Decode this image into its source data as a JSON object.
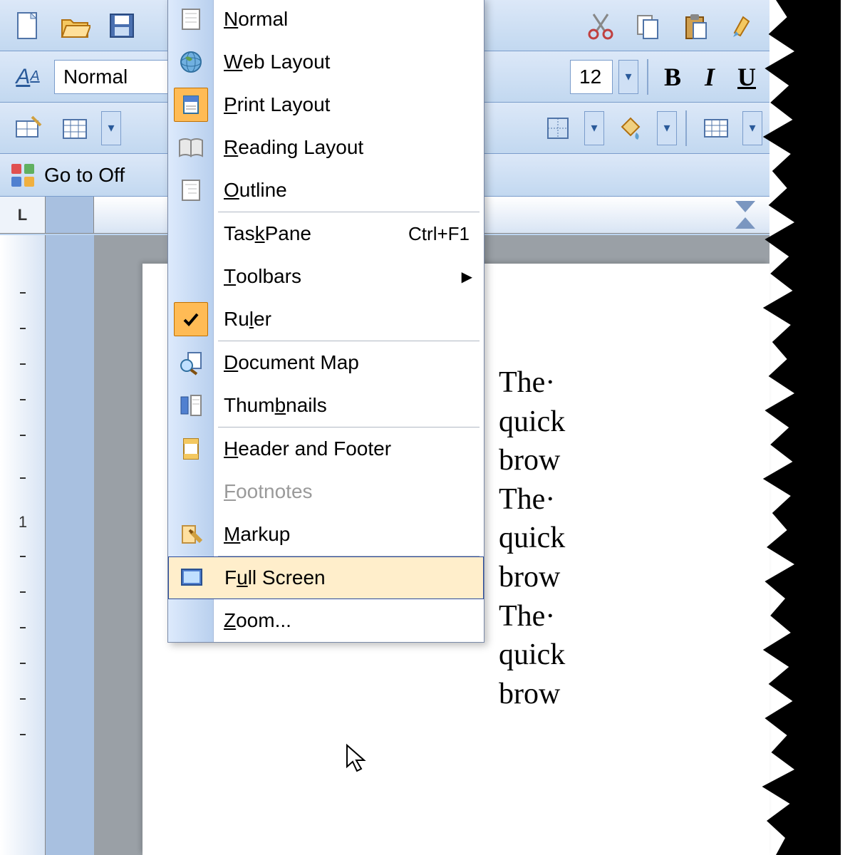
{
  "toolbar": {
    "style_label": "Normal",
    "font_size": "12",
    "go_to_office": "Go to Off"
  },
  "menu": {
    "items": [
      {
        "label_pre": "",
        "key": "N",
        "label_post": "ormal",
        "icon": "page-icon"
      },
      {
        "label_pre": "",
        "key": "W",
        "label_post": "eb Layout",
        "icon": "globe-icon"
      },
      {
        "label_pre": "",
        "key": "P",
        "label_post": "rint Layout",
        "icon": "print-layout-icon",
        "selected": true
      },
      {
        "label_pre": "",
        "key": "R",
        "label_post": "eading Layout",
        "icon": "book-icon"
      },
      {
        "label_pre": "",
        "key": "O",
        "label_post": "utline",
        "icon": "outline-icon"
      }
    ],
    "task_pane": {
      "label_pre": "Tas",
      "key": "k",
      "label_post": " Pane",
      "shortcut": "Ctrl+F1"
    },
    "toolbars": {
      "label_pre": "",
      "key": "T",
      "label_post": "oolbars",
      "submenu": true
    },
    "ruler": {
      "label_pre": "Ru",
      "key": "l",
      "label_post": "er",
      "checked": true
    },
    "docmap": {
      "label_pre": "",
      "key": "D",
      "label_post": "ocument Map",
      "icon": "magnifier-icon"
    },
    "thumbnails": {
      "label_pre": "Thum",
      "key": "b",
      "label_post": "nails",
      "icon": "thumbnails-icon"
    },
    "header": {
      "label_pre": "",
      "key": "H",
      "label_post": "eader and Footer",
      "icon": "header-footer-icon"
    },
    "footnotes": {
      "label_pre": "",
      "key": "F",
      "label_post": "ootnotes",
      "disabled": true
    },
    "markup": {
      "label_pre": "",
      "key": "M",
      "label_post": "arkup",
      "icon": "markup-icon"
    },
    "fullscreen": {
      "label_pre": "F",
      "key": "u",
      "label_post": "ll Screen",
      "icon": "fullscreen-icon",
      "hovered": true
    },
    "zoom": {
      "label_pre": "",
      "key": "Z",
      "label_post": "oom..."
    }
  },
  "document": {
    "lines": [
      "The·",
      "quick",
      "brow",
      "The·",
      "quick",
      "brow",
      "The·",
      "quick",
      "brow"
    ]
  },
  "ruler": {
    "corner": "⌐"
  }
}
